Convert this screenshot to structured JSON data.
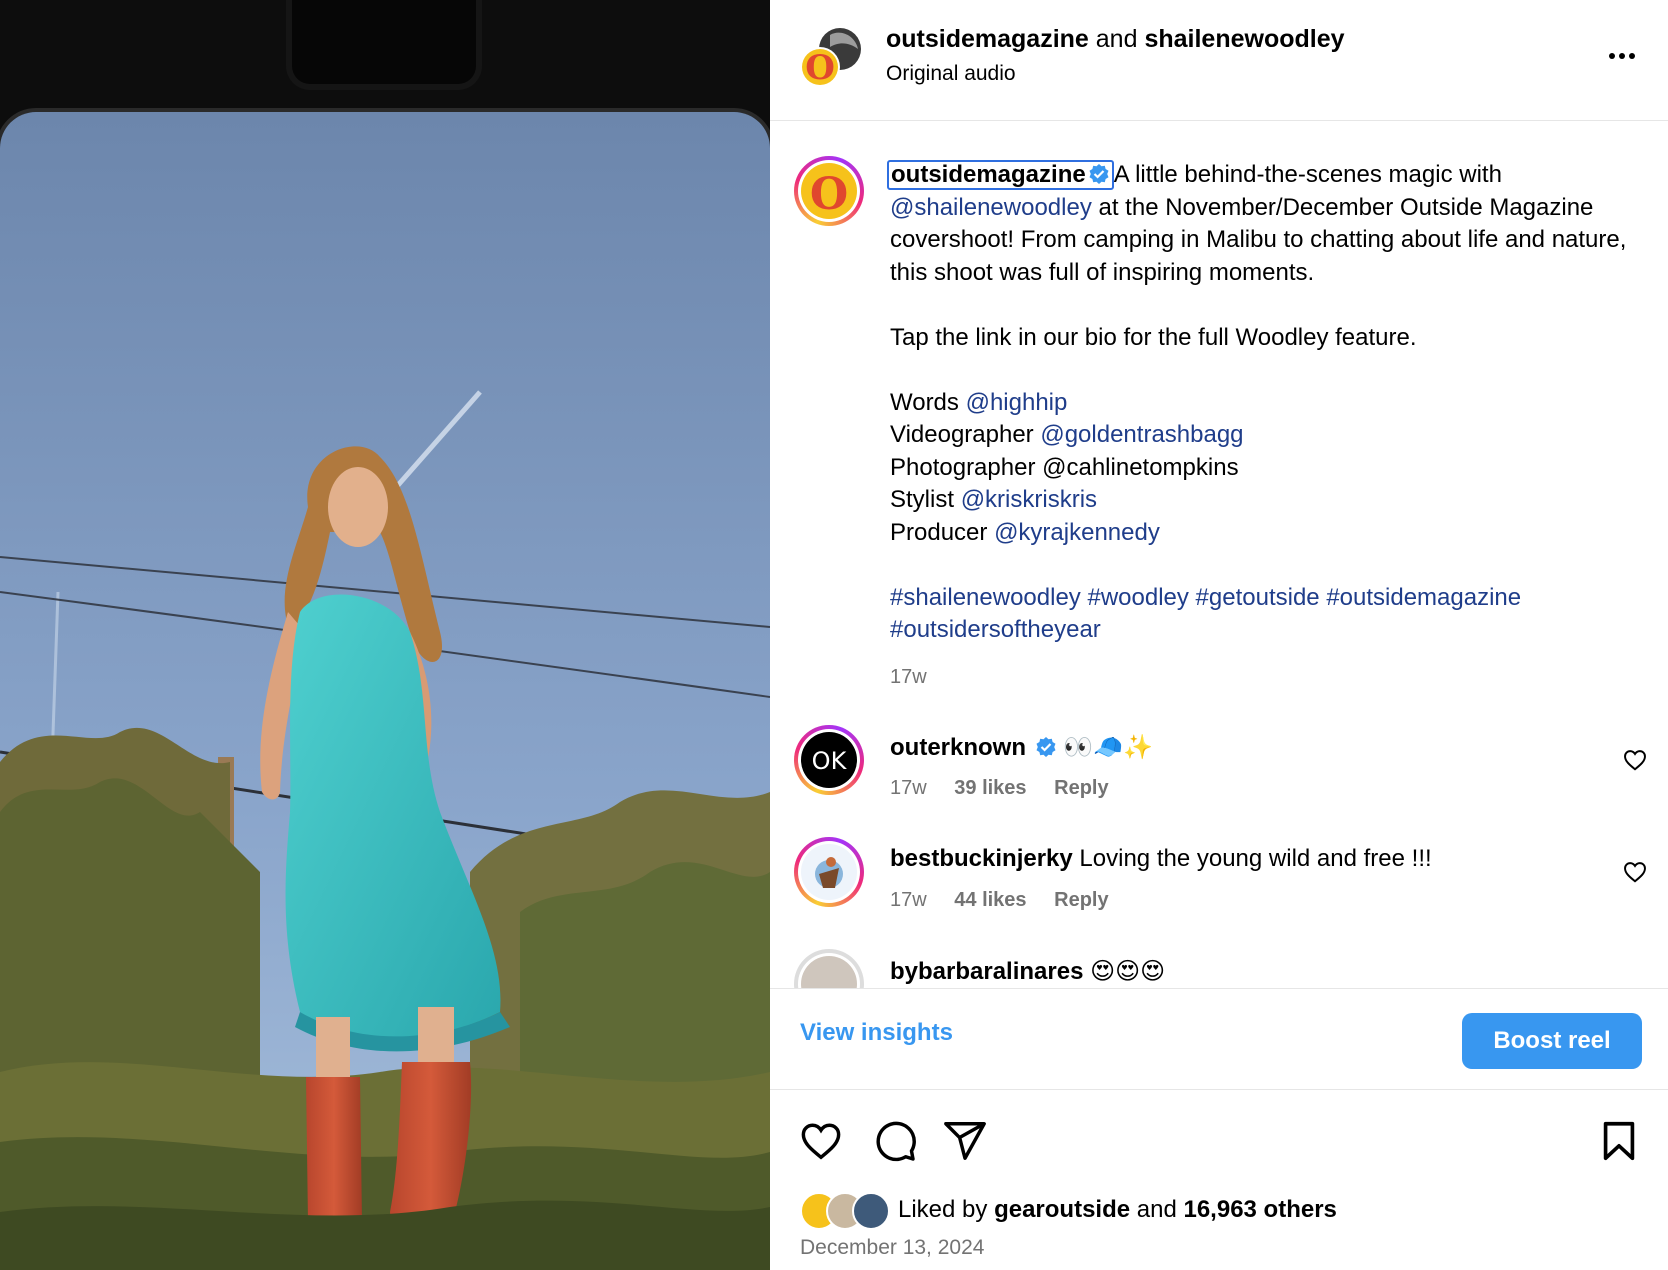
{
  "header": {
    "account": "outsidemagazine",
    "joiner": "and",
    "collaborator": "shailenewoodley",
    "audio": "Original audio"
  },
  "caption": {
    "username": "outsidemagazine",
    "line1_rest": "A little behind-the-scenes magic with",
    "mention_shailene": "@shailenewoodley",
    "line2_rest": "at the November/December Outside Magazine covershoot! From camping in Malibu to chatting about life and nature, this shoot was full of inspiring moments.",
    "tap_line": "Tap the link in our bio for the full Woodley feature.",
    "credits": [
      {
        "role": "Words",
        "handle": "@highhip",
        "is_link": true
      },
      {
        "role": "Videographer",
        "handle": "@goldentrashbagg",
        "is_link": true
      },
      {
        "role": "Photographer",
        "handle": "@cahlinetompkins",
        "is_link": false
      },
      {
        "role": "Stylist",
        "handle": "@kriskriskris",
        "is_link": true
      },
      {
        "role": "Producer",
        "handle": "@kyrajkennedy",
        "is_link": true
      }
    ],
    "hashtags_line1": "#shailenewoodley #woodley #getoutside #outsidemagazine",
    "hashtags_line2": "#outsidersoftheyear",
    "time": "17w"
  },
  "comments": [
    {
      "username": "outerknown",
      "verified": true,
      "text": "👀🧢✨",
      "time": "17w",
      "likes": "39 likes",
      "reply": "Reply"
    },
    {
      "username": "bestbuckinjerky",
      "verified": false,
      "text": "Loving the young wild and free !!!",
      "time": "17w",
      "likes": "44 likes",
      "reply": "Reply"
    },
    {
      "username": "bybarbaralinares",
      "verified": false,
      "text": "😍😍😍"
    }
  ],
  "actions": {
    "view_insights": "View insights",
    "boost": "Boost reel"
  },
  "likes": {
    "prefix": "Liked by",
    "user": "gearoutside",
    "joiner": "and",
    "count": "16,963 others"
  },
  "date": "December 13, 2024",
  "avatar_text": {
    "outside_logo": "O",
    "outerknown_logo": "OK"
  },
  "colors": {
    "link": "#1f3d8a",
    "accent": "#3897f0",
    "verified": "#3897f0",
    "muted": "#737373"
  },
  "icons": [
    "more-icon",
    "verified-badge-icon",
    "heart-icon",
    "comment-icon",
    "share-icon",
    "bookmark-icon"
  ]
}
